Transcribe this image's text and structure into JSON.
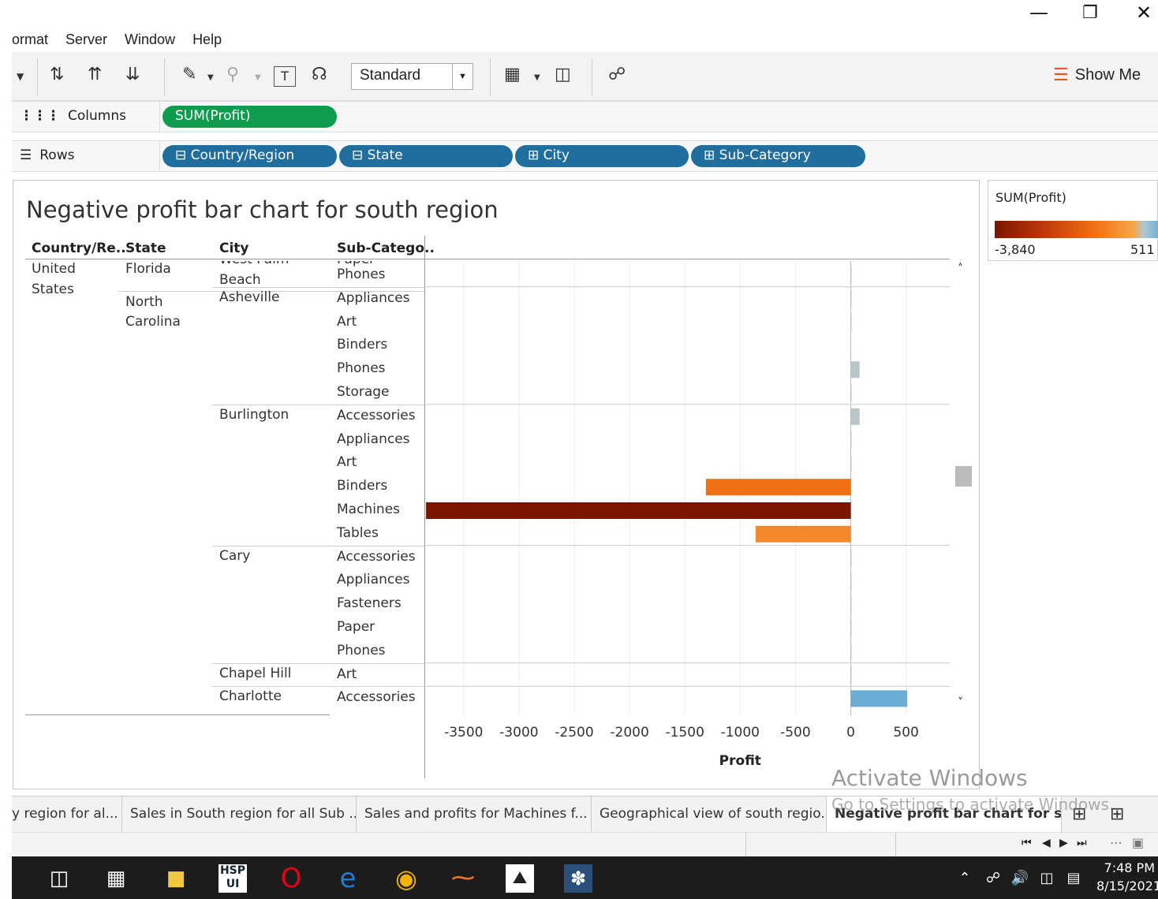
{
  "menu": [
    "ormat",
    "Server",
    "Window",
    "Help"
  ],
  "toolbar": {
    "view_mode": "Standard",
    "show_me": "Show Me"
  },
  "shelves": {
    "columns_label": "Columns",
    "rows_label": "Rows",
    "columns": [
      "SUM(Profit)"
    ],
    "rows": [
      "Country/Region",
      "State",
      "City",
      "Sub-Category"
    ]
  },
  "sheet": {
    "title": "Negative profit bar chart for south region",
    "headers": [
      "Country/Re..",
      "State",
      "City",
      "Sub-Catego.."
    ],
    "country_line1": "United",
    "country_line2": "States",
    "state_florida": "Florida",
    "state_nc_line1": "North",
    "state_nc_line2": "Carolina",
    "city_partial_line1": "West Palm",
    "city_partial_line2": "Beach",
    "partial_sub": "Paper"
  },
  "chart_data": {
    "type": "bar",
    "orientation": "horizontal",
    "xlabel": "Profit",
    "xlim": [
      -3840,
      511
    ],
    "xticks": [
      "-3500",
      "-3000",
      "-2500",
      "-2000",
      "-1500",
      "-1000",
      "-500",
      "0",
      "500"
    ],
    "xtick_values": [
      -3500,
      -3000,
      -2500,
      -2000,
      -1500,
      -1000,
      -500,
      0,
      500
    ],
    "rows": [
      {
        "city": "West Palm Beach",
        "sub": "Phones",
        "value": 0
      },
      {
        "city": "Asheville",
        "sub": "Appliances",
        "value": 0
      },
      {
        "city": "Asheville",
        "sub": "Art",
        "value": 0
      },
      {
        "city": "Asheville",
        "sub": "Binders",
        "value": -5
      },
      {
        "city": "Asheville",
        "sub": "Phones",
        "value": 80
      },
      {
        "city": "Asheville",
        "sub": "Storage",
        "value": 0
      },
      {
        "city": "Burlington",
        "sub": "Accessories",
        "value": 80
      },
      {
        "city": "Burlington",
        "sub": "Appliances",
        "value": 0
      },
      {
        "city": "Burlington",
        "sub": "Art",
        "value": 0
      },
      {
        "city": "Burlington",
        "sub": "Binders",
        "value": -1310
      },
      {
        "city": "Burlington",
        "sub": "Machines",
        "value": -3840
      },
      {
        "city": "Burlington",
        "sub": "Tables",
        "value": -860
      },
      {
        "city": "Cary",
        "sub": "Accessories",
        "value": 0
      },
      {
        "city": "Cary",
        "sub": "Appliances",
        "value": 5
      },
      {
        "city": "Cary",
        "sub": "Fasteners",
        "value": 0
      },
      {
        "city": "Cary",
        "sub": "Paper",
        "value": 0
      },
      {
        "city": "Cary",
        "sub": "Phones",
        "value": 5
      },
      {
        "city": "Chapel Hill",
        "sub": "Art",
        "value": 0
      },
      {
        "city": "Charlotte",
        "sub": "Accessories",
        "value": 511
      }
    ]
  },
  "legend": {
    "title": "SUM(Profit)",
    "min": "-3,840",
    "max": "511"
  },
  "tabs": [
    "y region for al...",
    "Sales in South region for all Sub ...",
    "Sales and profits for Machines f...",
    "Geographical view of south regio...",
    "Negative profit bar chart for so..."
  ],
  "watermark": {
    "line1": "Activate Windows",
    "line2": "Go to Settings to activate Windows."
  },
  "clock": {
    "time": "7:48 PM",
    "date": "8/15/2021"
  },
  "colors": {
    "neg_dark": "#7b1500",
    "neg_mid": "#f07013",
    "neg_light": "#f5882b",
    "pos_light": "#b8c6c7",
    "pos": "#6aaed6",
    "green_pill": "#0f9c4f",
    "blue_pill": "#1f6e9e"
  }
}
